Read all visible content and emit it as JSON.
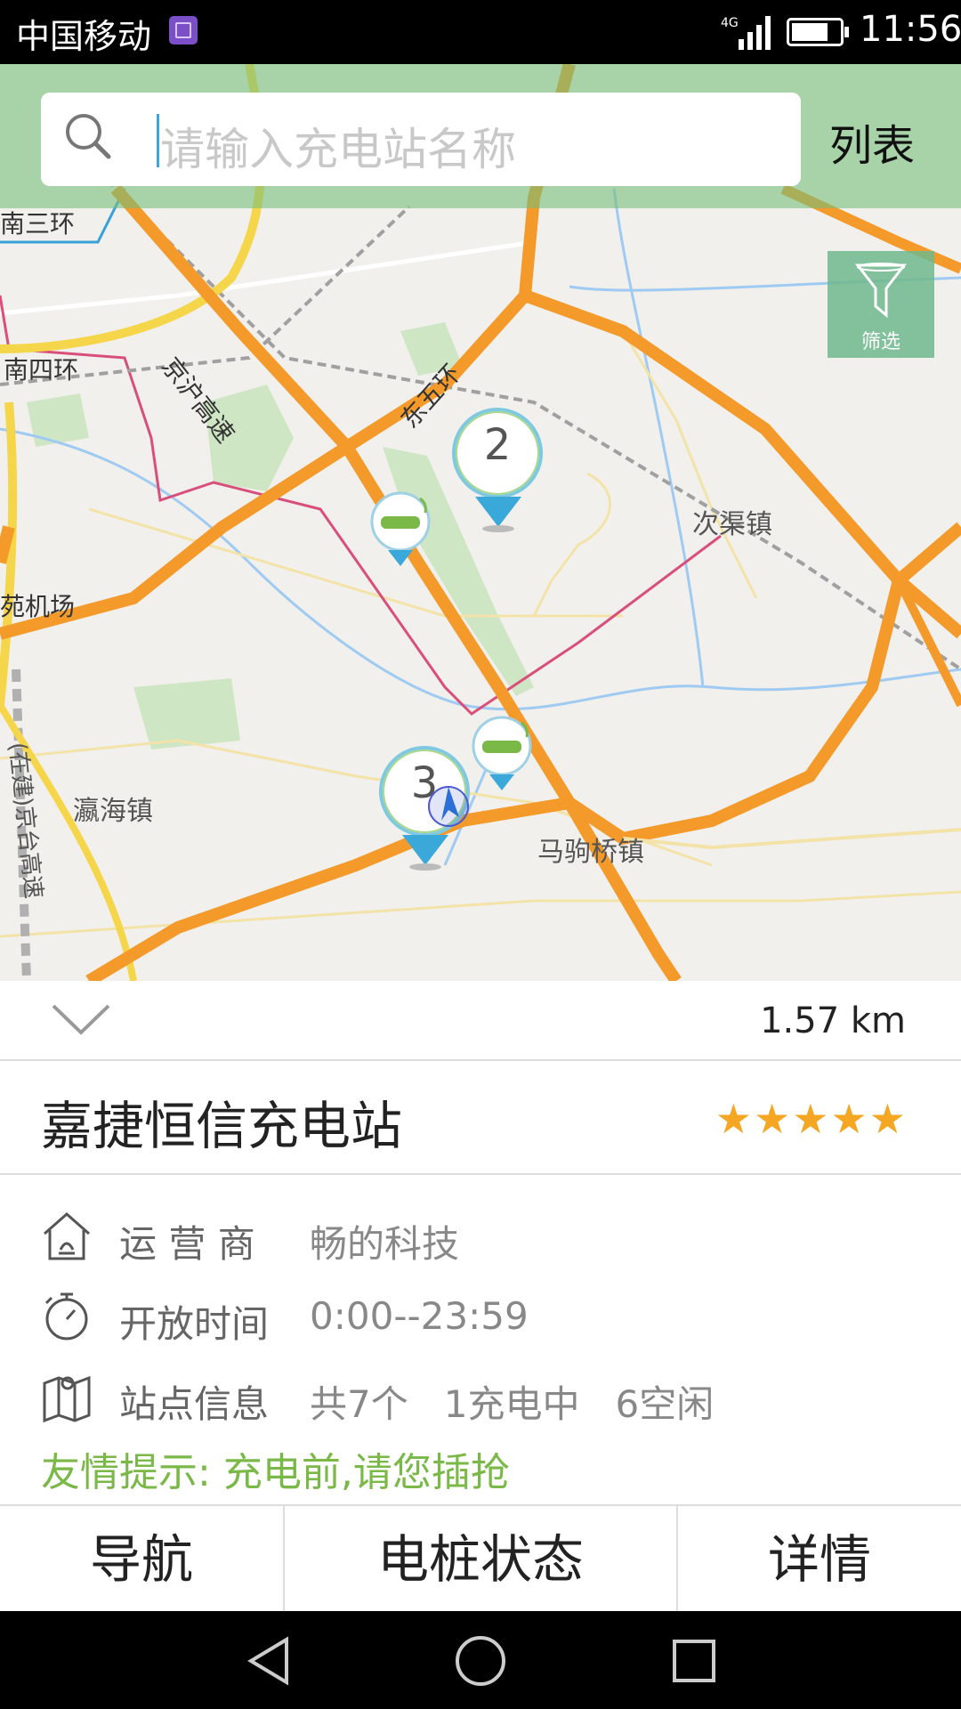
{
  "status_bar": {
    "carrier": "中国移动",
    "network": "4G",
    "time": "11:56"
  },
  "search": {
    "placeholder": "请输入充电站名称",
    "list_label": "列表"
  },
  "filter": {
    "label": "筛选"
  },
  "map": {
    "labels": {
      "south_3rd_ring": "南三环",
      "south_4th_ring": "南四环",
      "jinghu_highway": "京沪高速",
      "east_5th_ring": "东五环",
      "ciqu_town": "次渠镇",
      "airport": "苑机场",
      "yinghai_town": "瀛海镇",
      "majuqiao_town": "马驹桥镇",
      "jingtai_highway": "(在建)京台高速"
    },
    "clusters": [
      "2",
      "3"
    ],
    "colors": {
      "road_orange": "#f39a2a",
      "ring_yellow": "#f5d64a",
      "water_blue": "#9fcbf2",
      "green_area": "#cfe6c4",
      "rail_pink": "#d94f7b"
    }
  },
  "station": {
    "distance": "1.57 km",
    "name": "嘉捷恒信充电站",
    "rating": "★★★★★",
    "operator_label": "运 营 商",
    "operator_value": "畅的科技",
    "hours_label": "开放时间",
    "hours_value": "0:00--23:59",
    "info_label": "站点信息",
    "info_value": "共7个   1充电中   6空闲",
    "tip_label": "友情提示:",
    "tip_value": "充电前,请您插抢"
  },
  "actions": {
    "navigate": "导航",
    "pile_status": "电桩状态",
    "details": "详情"
  },
  "icons": {
    "search": "search-icon",
    "filter": "funnel-icon",
    "collapse": "chevron-down-icon",
    "operator": "house-icon",
    "hours": "stopwatch-icon",
    "info": "map-icon",
    "back": "back-triangle-icon",
    "home": "home-circle-icon",
    "recents": "recents-square-icon"
  },
  "accent_color": "#7ab848"
}
